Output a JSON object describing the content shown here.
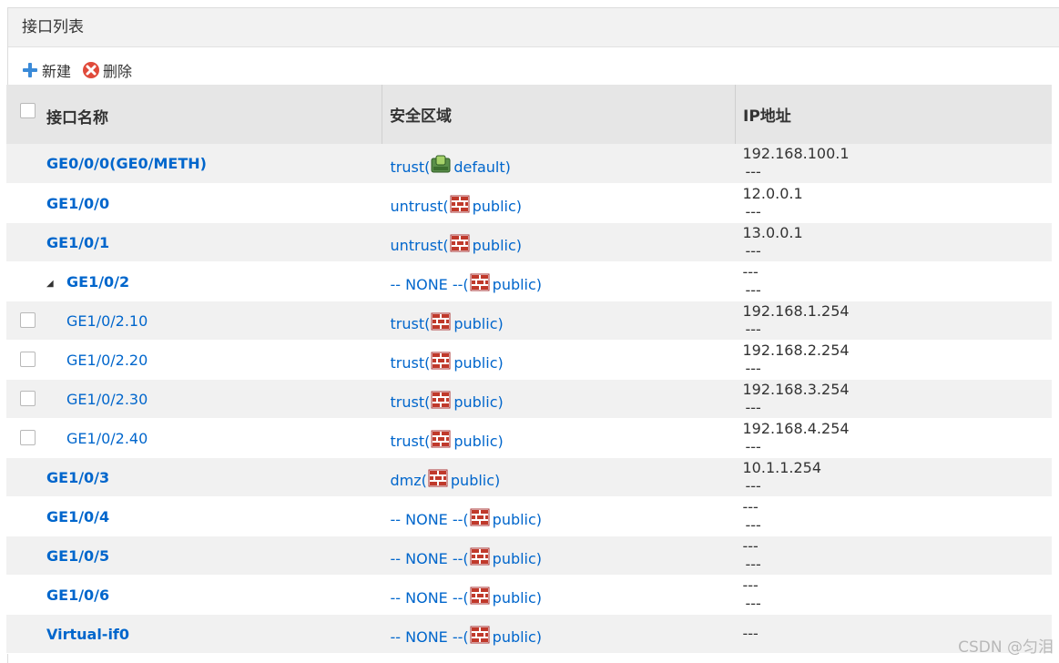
{
  "panel": {
    "title": "接口列表"
  },
  "toolbar": {
    "new_label": "新建",
    "delete_label": "删除"
  },
  "table": {
    "headers": [
      "接口名称",
      "安全区域",
      "IP地址"
    ],
    "rows": [
      {
        "name": "GE0/0/0(GE0/METH)",
        "bold": true,
        "level": 0,
        "checkbox": false,
        "zone_prefix": "trust(",
        "zone_icon": "vsys-root-icon",
        "zone_suffix": " default)",
        "ip1": "192.168.100.1",
        "ip2": "---"
      },
      {
        "name": "GE1/0/0",
        "bold": true,
        "level": 0,
        "checkbox": false,
        "zone_prefix": "untrust(",
        "zone_icon": "firewall-icon",
        "zone_suffix": " public)",
        "ip1": "12.0.0.1",
        "ip2": "---"
      },
      {
        "name": "GE1/0/1",
        "bold": true,
        "level": 0,
        "checkbox": false,
        "zone_prefix": "untrust(",
        "zone_icon": "firewall-icon",
        "zone_suffix": " public)",
        "ip1": "13.0.0.1",
        "ip2": "---"
      },
      {
        "name": "GE1/0/2",
        "bold": true,
        "level": 0,
        "checkbox": false,
        "expanded": true,
        "zone_prefix": "-- NONE --(",
        "zone_icon": "firewall-icon",
        "zone_suffix": " public)",
        "ip1": "---",
        "ip2": "---"
      },
      {
        "name": "GE1/0/2.10",
        "bold": false,
        "level": 1,
        "checkbox": true,
        "zone_prefix": "trust(",
        "zone_icon": "firewall-icon",
        "zone_suffix": " public)",
        "ip1": "192.168.1.254",
        "ip2": "---"
      },
      {
        "name": "GE1/0/2.20",
        "bold": false,
        "level": 1,
        "checkbox": true,
        "zone_prefix": "trust(",
        "zone_icon": "firewall-icon",
        "zone_suffix": " public)",
        "ip1": "192.168.2.254",
        "ip2": "---"
      },
      {
        "name": "GE1/0/2.30",
        "bold": false,
        "level": 1,
        "checkbox": true,
        "zone_prefix": "trust(",
        "zone_icon": "firewall-icon",
        "zone_suffix": " public)",
        "ip1": "192.168.3.254",
        "ip2": "---"
      },
      {
        "name": "GE1/0/2.40",
        "bold": false,
        "level": 1,
        "checkbox": true,
        "zone_prefix": "trust(",
        "zone_icon": "firewall-icon",
        "zone_suffix": " public)",
        "ip1": "192.168.4.254",
        "ip2": "---"
      },
      {
        "name": "GE1/0/3",
        "bold": true,
        "level": 0,
        "checkbox": false,
        "zone_prefix": "dmz(",
        "zone_icon": "firewall-icon",
        "zone_suffix": " public)",
        "ip1": "10.1.1.254",
        "ip2": "---"
      },
      {
        "name": "GE1/0/4",
        "bold": true,
        "level": 0,
        "checkbox": false,
        "zone_prefix": "-- NONE --(",
        "zone_icon": "firewall-icon",
        "zone_suffix": " public)",
        "ip1": "---",
        "ip2": "---"
      },
      {
        "name": "GE1/0/5",
        "bold": true,
        "level": 0,
        "checkbox": false,
        "zone_prefix": "-- NONE --(",
        "zone_icon": "firewall-icon",
        "zone_suffix": " public)",
        "ip1": "---",
        "ip2": "---"
      },
      {
        "name": "GE1/0/6",
        "bold": true,
        "level": 0,
        "checkbox": false,
        "zone_prefix": "-- NONE --(",
        "zone_icon": "firewall-icon",
        "zone_suffix": " public)",
        "ip1": "---",
        "ip2": "---"
      },
      {
        "name": "Virtual-if0",
        "bold": true,
        "level": 0,
        "checkbox": false,
        "zone_prefix": "-- NONE --(",
        "zone_icon": "firewall-icon",
        "zone_suffix": " public)",
        "ip1": "---",
        "ip2": ""
      }
    ]
  },
  "watermark": "CSDN @匀泪",
  "colors": {
    "link": "#0066cc",
    "header_bg": "#e6e6e6",
    "row_alt": "#f1f1f1"
  }
}
